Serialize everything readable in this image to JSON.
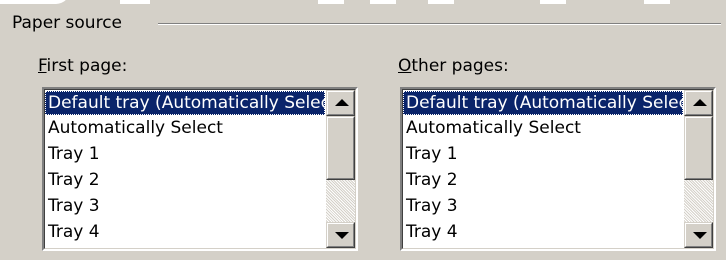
{
  "group": {
    "title": "Paper source"
  },
  "first_page": {
    "label_mnemonic": "F",
    "label_rest": "irst page:",
    "items": [
      "Default tray (Automatically Select)",
      "Automatically Select",
      "Tray 1",
      "Tray 2",
      "Tray 3",
      "Tray 4"
    ],
    "selected_index": 0
  },
  "other_pages": {
    "label_mnemonic": "O",
    "label_rest": "ther pages:",
    "items": [
      "Default tray (Automatically Select)",
      "Automatically Select",
      "Tray 1",
      "Tray 2",
      "Tray 3",
      "Tray 4"
    ],
    "selected_index": 0
  },
  "colors": {
    "dialog_bg": "#d4d0c8",
    "selection_bg": "#0a246a",
    "selection_text": "#ffffff"
  },
  "icons": {
    "scroll_up": "triangle-up",
    "scroll_down": "triangle-down"
  }
}
